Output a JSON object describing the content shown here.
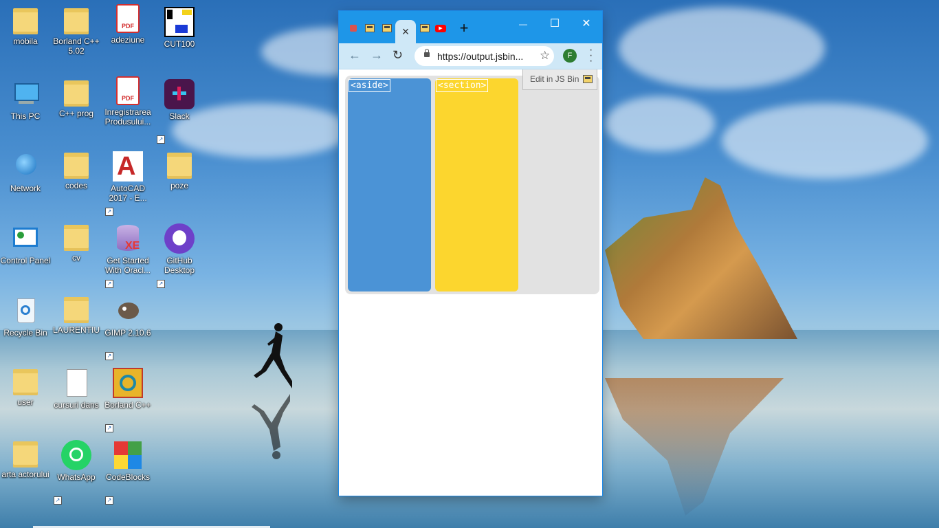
{
  "desktop": {
    "icons": [
      {
        "label": "mobila"
      },
      {
        "label": "Borland C++ 5.02"
      },
      {
        "label": "adeziune"
      },
      {
        "label": "CUT100"
      },
      {
        "label": "This PC"
      },
      {
        "label": "C++ prog"
      },
      {
        "label": "Inregistrarea Produsului..."
      },
      {
        "label": "Slack"
      },
      {
        "label": "Network"
      },
      {
        "label": "codes"
      },
      {
        "label": "AutoCAD 2017 - E..."
      },
      {
        "label": "poze"
      },
      {
        "label": "Control Panel"
      },
      {
        "label": "cv"
      },
      {
        "label": "Get Started With Oracl..."
      },
      {
        "label": "GitHub Desktop"
      },
      {
        "label": "Recycle Bin"
      },
      {
        "label": "LAURENTIU"
      },
      {
        "label": "GIMP 2.10.6"
      },
      {
        "label": "user"
      },
      {
        "label": "cursuri dans"
      },
      {
        "label": "Borland C++"
      },
      {
        "label": "arta actorului"
      },
      {
        "label": "WhatsApp"
      },
      {
        "label": "CodeBlocks"
      }
    ]
  },
  "browser": {
    "tab_close": "×",
    "new_tab": "+",
    "url": "https://output.jsbin...",
    "profile_initial": "F",
    "window_controls": {
      "minimize": "—",
      "maximize": "☐",
      "close": "✕"
    },
    "page": {
      "aside_tag": "<aside>",
      "section_tag": "<section>",
      "edit_in_jsbin": "Edit in JS Bin"
    }
  },
  "colors": {
    "aside": "#4b93d6",
    "section": "#fcd62e",
    "container": "#e2e2e2",
    "browser_frame": "#1e96e8"
  }
}
